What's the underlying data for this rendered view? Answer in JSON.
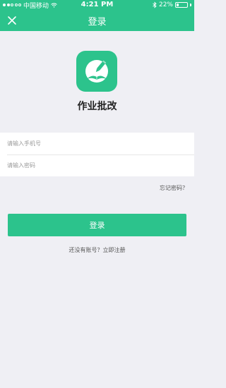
{
  "status_bar": {
    "carrier": "中国移动",
    "time": "4:21 PM",
    "battery": "22%",
    "battery_level": 0.22,
    "signal_bars": 2
  },
  "nav": {
    "title": "登录",
    "close_icon": "close-icon"
  },
  "app": {
    "name": "作业批改",
    "icon": "book-pencil-icon",
    "accent_color": "#2cc38c"
  },
  "form": {
    "phone_placeholder": "请输入手机号",
    "phone_value": "",
    "password_placeholder": "请输入密码",
    "password_value": ""
  },
  "forgot_password": "忘记密码？",
  "login_button": "登录",
  "register": {
    "prompt": "还没有账号？",
    "link": "立即注册"
  }
}
